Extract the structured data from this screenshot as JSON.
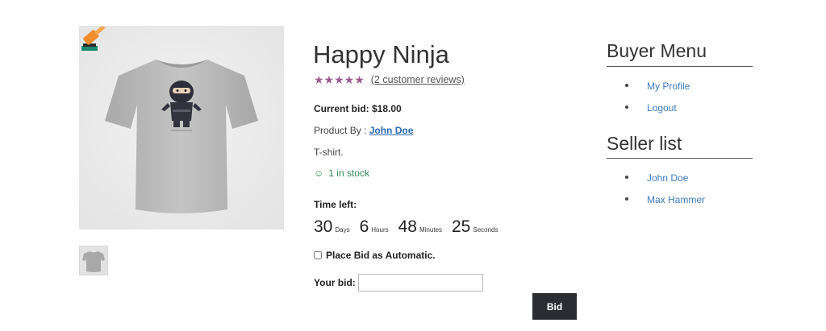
{
  "product": {
    "title": "Happy Ninja",
    "stars": "★★★★★",
    "review_link": "(2 customer reviews)",
    "current_bid": "Current bid: $18.00",
    "product_by_label": "Product By : ",
    "vendor": "John Doe",
    "description": "T-shirt.",
    "stock_icon": "☺",
    "stock": "1 in stock",
    "rating_color": "#9b5c8f",
    "stock_color": "#2e8b57"
  },
  "countdown": {
    "label": "Time left:",
    "days": "30",
    "days_label": "Days",
    "hours": "6",
    "hours_label": "Hours",
    "minutes": "48",
    "minutes_label": "Minutes",
    "seconds": "25",
    "seconds_label": "Seconds"
  },
  "bid_form": {
    "auto_label": "Place Bid as Automatic.",
    "your_bid_label": "Your bid:",
    "your_bid_value": "",
    "button_label": "Bid",
    "button_color": "#2b2d33"
  },
  "sidebar": {
    "buyer_menu": {
      "title": "Buyer Menu",
      "items": [
        {
          "label": "My Profile"
        },
        {
          "label": "Logout"
        }
      ]
    },
    "seller_list": {
      "title": "Seller list",
      "items": [
        {
          "label": "John Doe"
        },
        {
          "label": "Max Hammer"
        }
      ]
    },
    "link_color": "#3a7bbf"
  },
  "icons": {
    "auction_badge": "gavel-icon",
    "main_image": "t-shirt-image",
    "thumbnail": "t-shirt-thumbnail"
  }
}
